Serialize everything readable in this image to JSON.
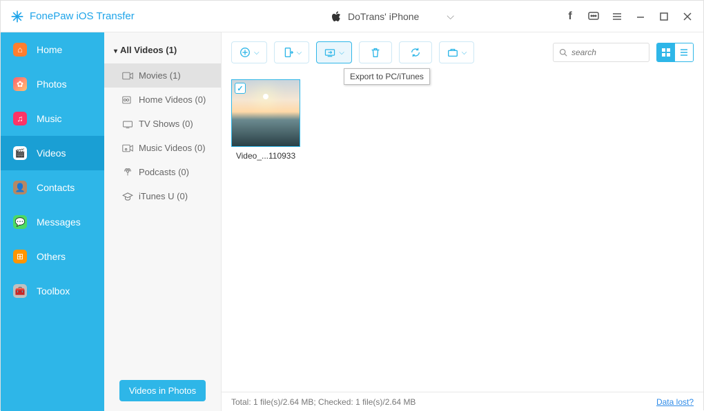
{
  "app_title": "FonePaw iOS Transfer",
  "device_name": "DoTrans' iPhone",
  "sidebar": [
    {
      "id": "home",
      "label": "Home"
    },
    {
      "id": "photos",
      "label": "Photos"
    },
    {
      "id": "music",
      "label": "Music"
    },
    {
      "id": "videos",
      "label": "Videos",
      "active": true
    },
    {
      "id": "contacts",
      "label": "Contacts"
    },
    {
      "id": "messages",
      "label": "Messages"
    },
    {
      "id": "others",
      "label": "Others"
    },
    {
      "id": "toolbox",
      "label": "Toolbox"
    }
  ],
  "videos_in_photos_label": "Videos in Photos",
  "categories": {
    "header": "All Videos (1)",
    "items": [
      {
        "id": "movies",
        "label": "Movies (1)",
        "selected": true
      },
      {
        "id": "home-videos",
        "label": "Home Videos (0)"
      },
      {
        "id": "tv-shows",
        "label": "TV Shows (0)"
      },
      {
        "id": "music-videos",
        "label": "Music Videos (0)"
      },
      {
        "id": "podcasts",
        "label": "Podcasts (0)"
      },
      {
        "id": "itunes-u",
        "label": "iTunes U (0)"
      }
    ]
  },
  "toolbar_tooltip": "Export to PC/iTunes",
  "search_placeholder": "search",
  "grid_item": {
    "label": "Video_...110933",
    "checked": true
  },
  "status": "Total: 1 file(s)/2.64 MB; Checked: 1 file(s)/2.64 MB",
  "data_lost_label": "Data lost?"
}
